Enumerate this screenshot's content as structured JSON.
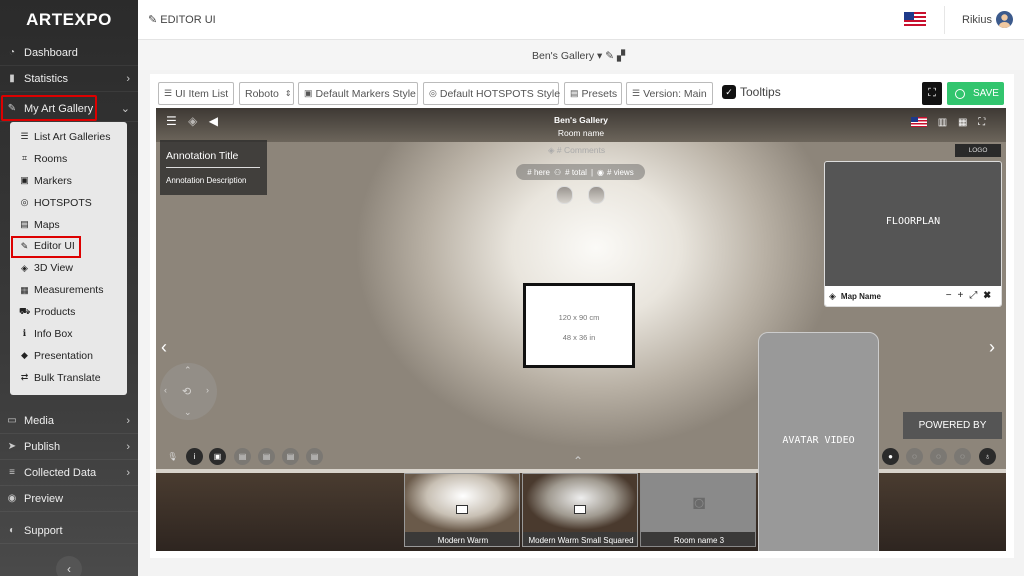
{
  "brand": {
    "logo_text": "ARTEXPO"
  },
  "sidebar": {
    "items_top": [
      {
        "label": "Dashboard",
        "icon": "dashboard-icon"
      },
      {
        "label": "Statistics",
        "icon": "chart-icon"
      }
    ],
    "gallery_label": "My Art Gallery",
    "submenu": [
      {
        "label": "List Art Galleries",
        "icon": "list-icon"
      },
      {
        "label": "Rooms",
        "icon": "room-icon"
      },
      {
        "label": "Markers",
        "icon": "marker-icon"
      },
      {
        "label": "HOTSPOTS",
        "icon": "target-icon"
      },
      {
        "label": "Maps",
        "icon": "map-icon"
      },
      {
        "label": "Editor UI",
        "icon": "editor-icon"
      },
      {
        "label": "3D View",
        "icon": "cube-icon"
      },
      {
        "label": "Measurements",
        "icon": "ruler-icon"
      },
      {
        "label": "Products",
        "icon": "cart-icon"
      },
      {
        "label": "Info Box",
        "icon": "info-icon"
      },
      {
        "label": "Presentation",
        "icon": "presentation-icon"
      },
      {
        "label": "Bulk Translate",
        "icon": "translate-icon"
      }
    ],
    "items_bottom": [
      {
        "label": "Media"
      },
      {
        "label": "Publish"
      },
      {
        "label": "Collected Data"
      },
      {
        "label": "Preview"
      },
      {
        "label": "Support"
      }
    ]
  },
  "topbar": {
    "crumb": "EDITOR UI",
    "user_name": "Rikius"
  },
  "subheader": {
    "gallery_name": "Ben's Gallery"
  },
  "toolbar": {
    "ui_item_list": "UI Item List",
    "font": "Roboto",
    "markers_style": "Default Markers Style",
    "hotspots_style": "Default HOTSPOTS Style",
    "presets": "Presets",
    "version": "Version: Main",
    "tooltips": "Tooltips",
    "save": "SAVE"
  },
  "viewport": {
    "gallery_title": "Ben's Gallery",
    "room_name": "Room name",
    "annotation_title": "Annotation Title",
    "annotation_desc": "Annotation Description",
    "comments": "# Comments",
    "here": "# here",
    "total": "# total",
    "views": "# views",
    "art_dim_cm": "120 x 90 cm",
    "art_dim_in": "48 x 36 in",
    "logo": "LOGO",
    "floorplan": "FLOORPLAN",
    "map_name": "Map Name",
    "avatar_video": "AVATAR VIDEO",
    "powered_by": "POWERED BY",
    "rooms": [
      "Modern Warm",
      "Modern Warm Small Squared",
      "Room name 3"
    ]
  },
  "colors": {
    "save_green": "#32c56e",
    "highlight_red": "#dd0000",
    "sidebar_dark": "#2b2b2b"
  }
}
